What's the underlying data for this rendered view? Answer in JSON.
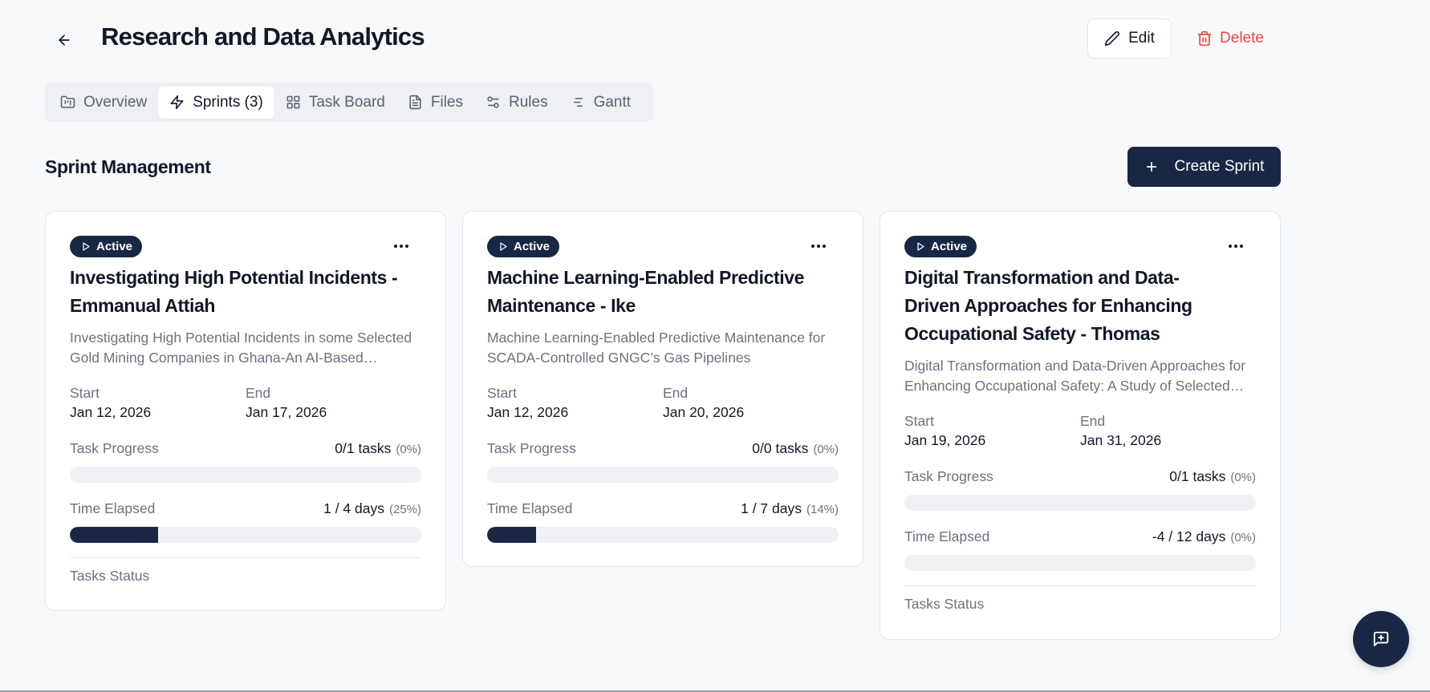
{
  "header": {
    "back_icon": "arrow-left-icon",
    "title": "Research and Data Analytics",
    "edit_label": "Edit",
    "delete_label": "Delete"
  },
  "tabs": [
    {
      "label": "Overview",
      "icon": "folder-icon",
      "active": false
    },
    {
      "label": "Sprints (3)",
      "icon": "lightning-icon",
      "active": true
    },
    {
      "label": "Task Board",
      "icon": "grid-icon",
      "active": false
    },
    {
      "label": "Files",
      "icon": "file-icon",
      "active": false
    },
    {
      "label": "Rules",
      "icon": "sliders-icon",
      "active": false
    },
    {
      "label": "Gantt",
      "icon": "gantt-icon",
      "active": false
    }
  ],
  "section": {
    "title": "Sprint Management",
    "create_label": "Create Sprint"
  },
  "labels": {
    "start": "Start",
    "end": "End",
    "task_progress": "Task Progress",
    "time_elapsed": "Time Elapsed",
    "tasks_status": "Tasks Status"
  },
  "sprints": [
    {
      "status": "Active",
      "title": "Investigating High Potential Incidents - Emmanual Attiah",
      "description": "Investigating High Potential Incidents in some Selected Gold Mining Companies in Ghana-An AI-Based Approach",
      "start": "Jan 12, 2026",
      "end": "Jan 17, 2026",
      "tasks_text": "0/1 tasks",
      "tasks_pct_text": "(0%)",
      "task_progress": 0,
      "time_text": "1 / 4 days",
      "time_pct_text": "(25%)",
      "time_progress": 0.25,
      "show_tasks_status": true
    },
    {
      "status": "Active",
      "title": "Machine Learning-Enabled Predictive Maintenance - Ike",
      "description": "Machine Learning-Enabled Predictive Maintenance for SCADA-Controlled GNGC’s Gas Pipelines",
      "start": "Jan 12, 2026",
      "end": "Jan 20, 2026",
      "tasks_text": "0/0 tasks",
      "tasks_pct_text": "(0%)",
      "task_progress": 0,
      "time_text": "1 / 7 days",
      "time_pct_text": "(14%)",
      "time_progress": 0.14,
      "show_tasks_status": false
    },
    {
      "status": "Active",
      "title": "Digital Transformation and Data-Driven Approaches for Enhancing Occupational Safety - Thomas",
      "description": "Digital Transformation and Data-Driven Approaches for Enhancing Occupational Safety: A Study of Selected Companies",
      "start": "Jan 19, 2026",
      "end": "Jan 31, 2026",
      "tasks_text": "0/1 tasks",
      "tasks_pct_text": "(0%)",
      "task_progress": 0,
      "time_text": "-4 / 12 days",
      "time_pct_text": "(0%)",
      "time_progress": 0,
      "show_tasks_status": true
    }
  ],
  "fab_icon": "chat-plus-icon"
}
